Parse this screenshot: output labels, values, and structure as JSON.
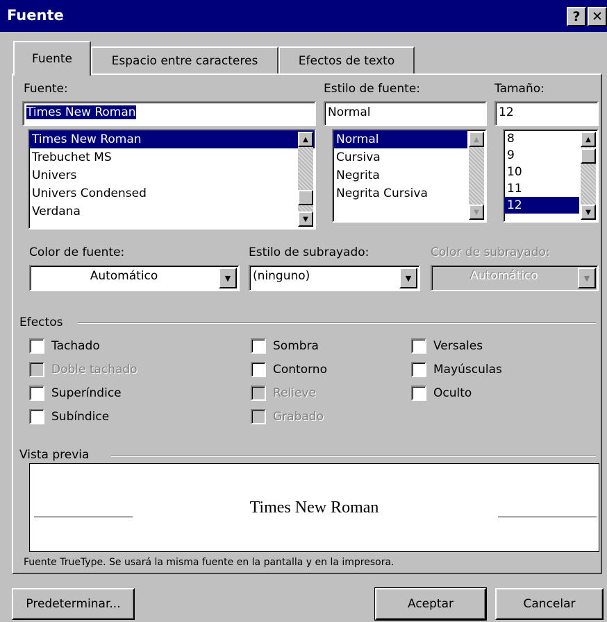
{
  "window": {
    "title": "Fuente",
    "help_button": "?",
    "close_button": "✕"
  },
  "tabs": [
    {
      "label": "Fuente",
      "active": true
    },
    {
      "label": "Espacio entre caracteres",
      "active": false
    },
    {
      "label": "Efectos de texto",
      "active": false
    }
  ],
  "font": {
    "label": "Fuente:",
    "value": "Times New Roman",
    "items": [
      "Times New Roman",
      "Trebuchet MS",
      "Univers",
      "Univers Condensed",
      "Verdana"
    ],
    "selected_index": 0
  },
  "style": {
    "label": "Estilo de fuente:",
    "value": "Normal",
    "items": [
      "Normal",
      "Cursiva",
      "Negrita",
      "Negrita Cursiva"
    ],
    "selected_index": 0
  },
  "size": {
    "label": "Tamaño:",
    "value": "12",
    "items": [
      "8",
      "9",
      "10",
      "11",
      "12"
    ],
    "selected_index": 4
  },
  "font_color": {
    "label": "Color de fuente:",
    "value": "Automático"
  },
  "underline_style": {
    "label": "Estilo de subrayado:",
    "value": "(ninguno)"
  },
  "underline_color": {
    "label": "Color de subrayado:",
    "value": "Automático",
    "enabled": false
  },
  "effects": {
    "label": "Efectos",
    "col1": [
      {
        "label": "Tachado",
        "checked": false,
        "enabled": true
      },
      {
        "label": "Doble tachado",
        "checked": false,
        "enabled": false
      },
      {
        "label": "Superíndice",
        "checked": false,
        "enabled": true
      },
      {
        "label": "Subíndice",
        "checked": false,
        "enabled": true
      }
    ],
    "col2": [
      {
        "label": "Sombra",
        "checked": false,
        "enabled": true
      },
      {
        "label": "Contorno",
        "checked": false,
        "enabled": true
      },
      {
        "label": "Relieve",
        "checked": false,
        "enabled": false
      },
      {
        "label": "Grabado",
        "checked": false,
        "enabled": false
      }
    ],
    "col3": [
      {
        "label": "Versales",
        "checked": false,
        "enabled": true
      },
      {
        "label": "Mayúsculas",
        "checked": false,
        "enabled": true
      },
      {
        "label": "Oculto",
        "checked": false,
        "enabled": true
      }
    ]
  },
  "preview": {
    "label": "Vista previa",
    "sample_text": "Times New Roman",
    "note": "Fuente TrueType. Se usará la misma fuente en la pantalla y en la impresora."
  },
  "buttons": {
    "default": "Predeterminar...",
    "ok": "Aceptar",
    "cancel": "Cancelar"
  }
}
